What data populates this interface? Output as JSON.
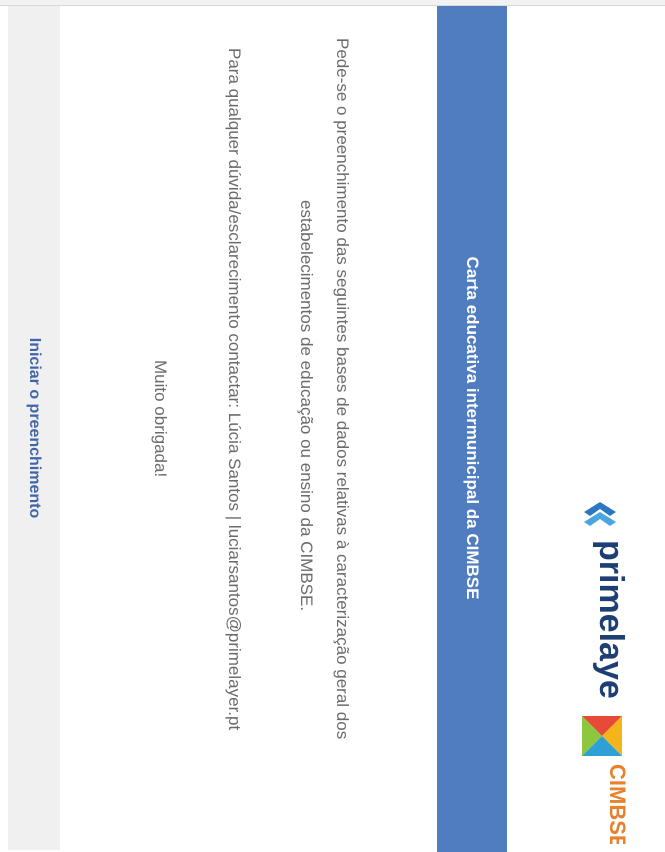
{
  "header": {
    "title": "Carta educativa intermunicipal da CIMBSE"
  },
  "body": {
    "line1": "Pede-se o preenchimento das seguintes bases de dados relativas à caracterização geral dos",
    "line2": "estabelecimentos de educação ou ensino da CIMBSE.",
    "line3": "Para qualquer dúvida/esclarecimento contactar: Lúcia Santos | luciarsantos@primelayer.pt",
    "line4": "Muito obrigada!"
  },
  "actions": {
    "start_label": "Iniciar o preenchimento"
  },
  "logos": {
    "primelayer": "primelayer",
    "cimbse": "CIMBSE"
  },
  "colors": {
    "band": "#4f7dc0",
    "start_text": "#3f66a8"
  }
}
